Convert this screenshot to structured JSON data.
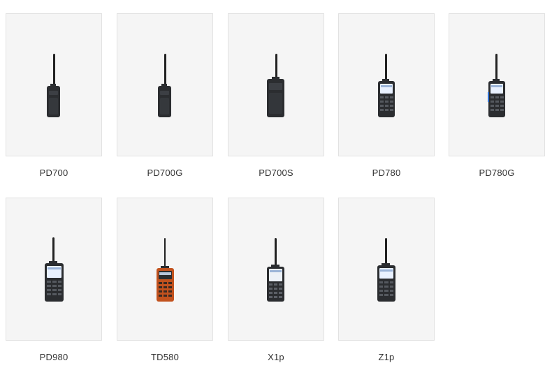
{
  "products": [
    {
      "name": "PD700",
      "icon": "radio-keypadless-icon"
    },
    {
      "name": "PD700G",
      "icon": "radio-keypadless-icon"
    },
    {
      "name": "PD700S",
      "icon": "radio-slim-icon"
    },
    {
      "name": "PD780",
      "icon": "radio-keypad-icon"
    },
    {
      "name": "PD780G",
      "icon": "radio-keypad-blue-icon"
    },
    {
      "name": "PD980",
      "icon": "radio-keypad-large-screen-icon"
    },
    {
      "name": "TD580",
      "icon": "radio-orange-keypad-icon"
    },
    {
      "name": "X1p",
      "icon": "radio-slim-keypad-icon"
    },
    {
      "name": "Z1p",
      "icon": "radio-compact-keypad-icon"
    }
  ],
  "colors": {
    "card_bg": "#f5f5f5",
    "card_border": "#e2e2e2",
    "label": "#333333",
    "radio_body": "#2b2d30",
    "screen": "#e9f1ff",
    "accent_orange": "#c2521e",
    "accent_blue": "#2f6fd0"
  }
}
